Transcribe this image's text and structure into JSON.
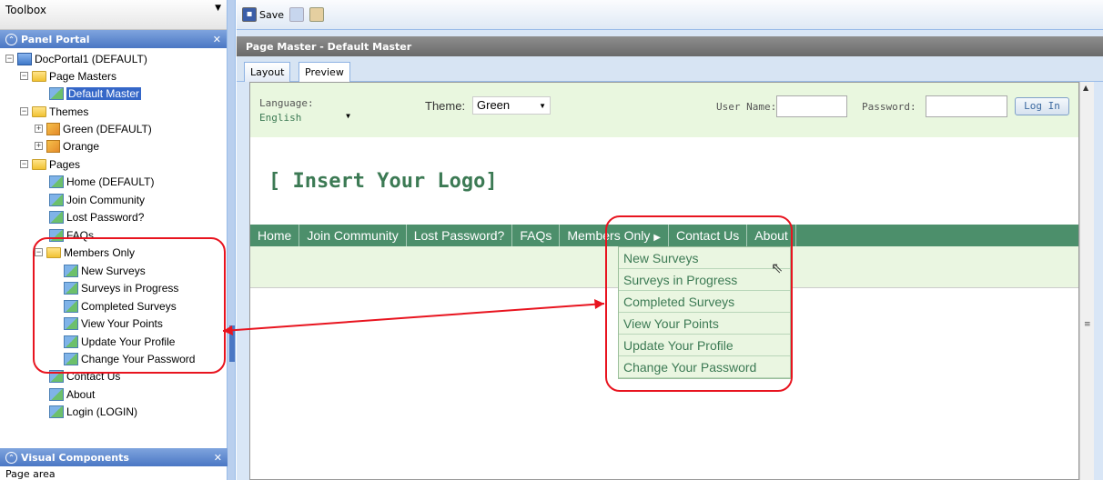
{
  "toolbox": {
    "title": "Toolbox"
  },
  "panel_portal": {
    "title": "Panel Portal"
  },
  "tree": {
    "root": "DocPortal1 (DEFAULT)",
    "page_masters": "Page Masters",
    "default_master": "Default Master",
    "themes": "Themes",
    "theme_green": "Green (DEFAULT)",
    "theme_orange": "Orange",
    "pages": "Pages",
    "home": "Home (DEFAULT)",
    "join": "Join Community",
    "lost": "Lost Password?",
    "faqs": "FAQs",
    "members": "Members Only",
    "m1": "New Surveys",
    "m2": "Surveys in Progress",
    "m3": "Completed Surveys",
    "m4": "View Your Points",
    "m5": "Update Your Profile",
    "m6": "Change Your Password",
    "contact": "Contact Us",
    "about": "About",
    "login": "Login (LOGIN)"
  },
  "visual_components": {
    "title": "Visual Components",
    "first_item": "Page area"
  },
  "toolbar": {
    "save": "Save"
  },
  "page_master_title": "Page Master - Default Master",
  "tabs": {
    "layout": "Layout",
    "preview": "Preview"
  },
  "preview": {
    "language_label": "Language:",
    "language_value": "English",
    "theme_label": "Theme:",
    "theme_value": "Green",
    "username_label": "User Name:",
    "password_label": "Password:",
    "login_button": "Log In",
    "logo": "[ Insert Your Logo]",
    "nav": [
      "Home",
      "Join Community",
      "Lost Password?",
      "FAQs",
      "Members Only",
      "Contact Us",
      "About"
    ],
    "dropdown": [
      "New Surveys",
      "Surveys in Progress",
      "Completed Surveys",
      "View Your Points",
      "Update Your Profile",
      "Change Your Password"
    ]
  },
  "colors": {
    "nav_bg": "#4c8f6b",
    "highlight": "#e8141f",
    "header_blue": "#4a77c4"
  }
}
